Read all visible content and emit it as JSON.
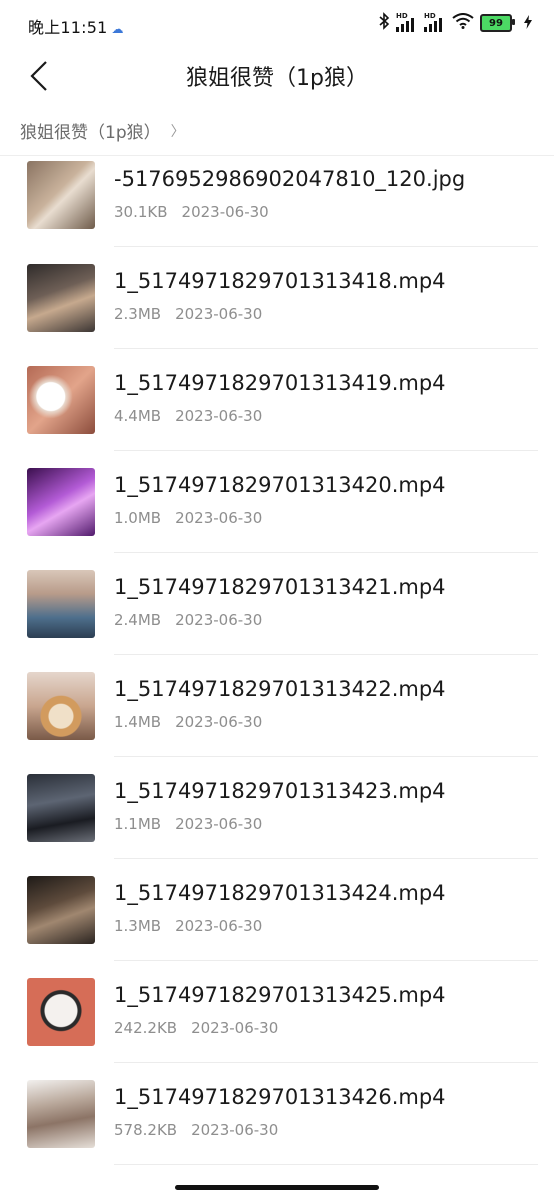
{
  "status": {
    "time": "晚上11:51",
    "battery": "99"
  },
  "header": {
    "title": "狼姐很赞（1p狼）"
  },
  "breadcrumb": {
    "path": "狼姐很赞（1p狼）"
  },
  "files": [
    {
      "name": "-5176952986902047810_120.jpg",
      "size": "30.1KB",
      "date": "2023-06-30"
    },
    {
      "name": "1_5174971829701313418.mp4",
      "size": "2.3MB",
      "date": "2023-06-30"
    },
    {
      "name": "1_5174971829701313419.mp4",
      "size": "4.4MB",
      "date": "2023-06-30"
    },
    {
      "name": "1_5174971829701313420.mp4",
      "size": "1.0MB",
      "date": "2023-06-30"
    },
    {
      "name": "1_5174971829701313421.mp4",
      "size": "2.4MB",
      "date": "2023-06-30"
    },
    {
      "name": "1_5174971829701313422.mp4",
      "size": "1.4MB",
      "date": "2023-06-30"
    },
    {
      "name": "1_5174971829701313423.mp4",
      "size": "1.1MB",
      "date": "2023-06-30"
    },
    {
      "name": "1_5174971829701313424.mp4",
      "size": "1.3MB",
      "date": "2023-06-30"
    },
    {
      "name": "1_5174971829701313425.mp4",
      "size": "242.2KB",
      "date": "2023-06-30"
    },
    {
      "name": "1_5174971829701313426.mp4",
      "size": "578.2KB",
      "date": "2023-06-30"
    }
  ]
}
